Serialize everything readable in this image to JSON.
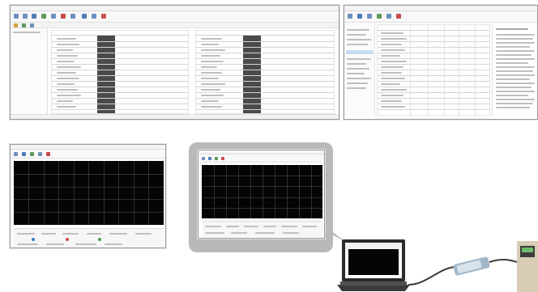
{
  "colors": {
    "scope_background": "#050505",
    "bubble": "#b9b9b9",
    "table_dark_column": "#4a4a4a",
    "selection_blue": "#c9dcf4",
    "laptop_body": "#2b2b2b",
    "drive_unit": "#d8cdb4"
  }
}
